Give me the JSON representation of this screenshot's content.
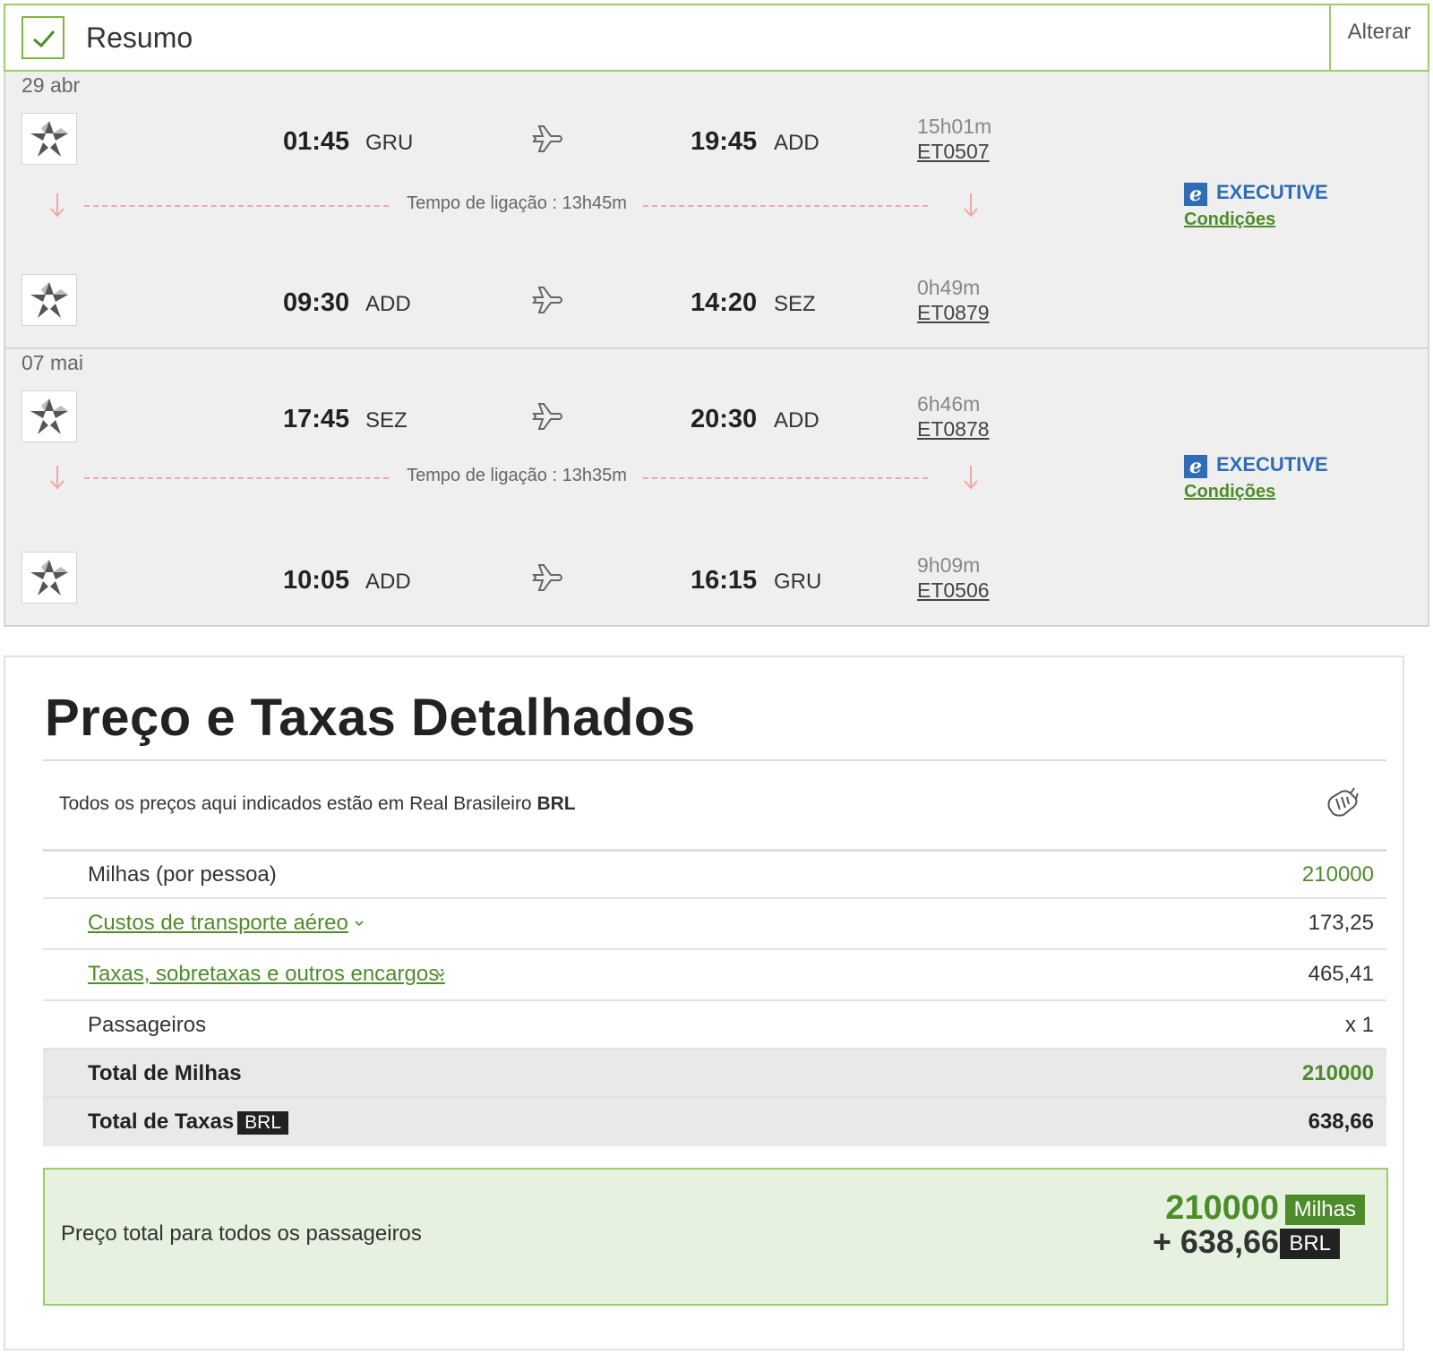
{
  "summary": {
    "title": "Resumo",
    "change_label": "Alterar"
  },
  "bounds": [
    {
      "date": "29 abr",
      "cabin": {
        "badge": "e",
        "label": "EXECUTIVE",
        "conditions": "Condições"
      },
      "connection": "Tempo de ligação : 13h45m",
      "segments": [
        {
          "dep_time": "01:45",
          "dep_code": "GRU",
          "arr_time": "19:45",
          "arr_code": "ADD",
          "duration": "15h01m",
          "flight": "ET0507"
        },
        {
          "dep_time": "09:30",
          "dep_code": "ADD",
          "arr_time": "14:20",
          "arr_code": "SEZ",
          "duration": "0h49m",
          "flight": "ET0879"
        }
      ]
    },
    {
      "date": "07 mai",
      "cabin": {
        "badge": "e",
        "label": "EXECUTIVE",
        "conditions": "Condições"
      },
      "connection": "Tempo de ligação : 13h35m",
      "segments": [
        {
          "dep_time": "17:45",
          "dep_code": "SEZ",
          "arr_time": "20:30",
          "arr_code": "ADD",
          "duration": "6h46m",
          "flight": "ET0878"
        },
        {
          "dep_time": "10:05",
          "dep_code": "ADD",
          "arr_time": "16:15",
          "arr_code": "GRU",
          "duration": "9h09m",
          "flight": "ET0506"
        }
      ]
    }
  ],
  "price": {
    "title": "Preço e Taxas Detalhados",
    "currency_note": "Todos os preços aqui indicados estão em Real Brasileiro",
    "currency_code": "BRL",
    "rows": {
      "miles_label": "Milhas (por pessoa)",
      "miles_value": "210000",
      "transport_label": "Custos de transporte aéreo",
      "transport_value": "173,25",
      "taxes_label": "Taxas, sobretaxas e outros encargos:",
      "taxes_value": "465,41",
      "passengers_label": "Passageiros",
      "passengers_value": "x 1",
      "total_miles_label": "Total de Milhas",
      "total_miles_value": "210000",
      "total_taxes_label": "Total de Taxas",
      "total_taxes_tag": "BRL",
      "total_taxes_value": "638,66"
    },
    "total": {
      "label": "Preço total para todos os passageiros",
      "miles": "210000",
      "miles_tag": "Milhas",
      "brl": "+ 638,66",
      "brl_tag": "BRL"
    }
  },
  "colors": {
    "accent_green": "#4e8c2b",
    "border_green": "#9acd63",
    "cabin_blue": "#2e6db4",
    "connection_red": "#f0a7a7",
    "total_bg": "#e6f2df"
  },
  "icons": [
    "check-icon",
    "airline-logo-star",
    "plane-icon",
    "arrow-down-icon",
    "chevron-down-icon",
    "money-icon"
  ]
}
